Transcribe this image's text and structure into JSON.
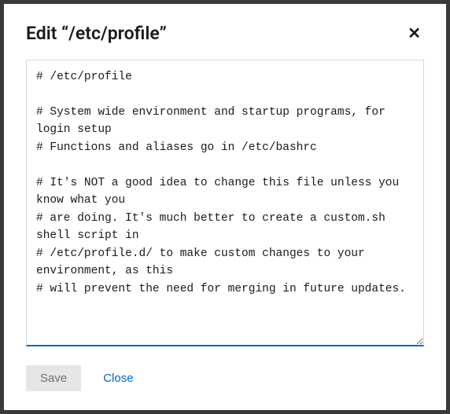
{
  "modal": {
    "title": "Edit “/etc/profile”",
    "close_icon_label": "✕",
    "editor_content": "# /etc/profile\n\n# System wide environment and startup programs, for login setup\n# Functions and aliases go in /etc/bashrc\n\n# It's NOT a good idea to change this file unless you know what you\n# are doing. It's much better to create a custom.sh shell script in\n# /etc/profile.d/ to make custom changes to your environment, as this\n# will prevent the need for merging in future updates.\n",
    "footer": {
      "save_label": "Save",
      "close_label": "Close"
    }
  }
}
